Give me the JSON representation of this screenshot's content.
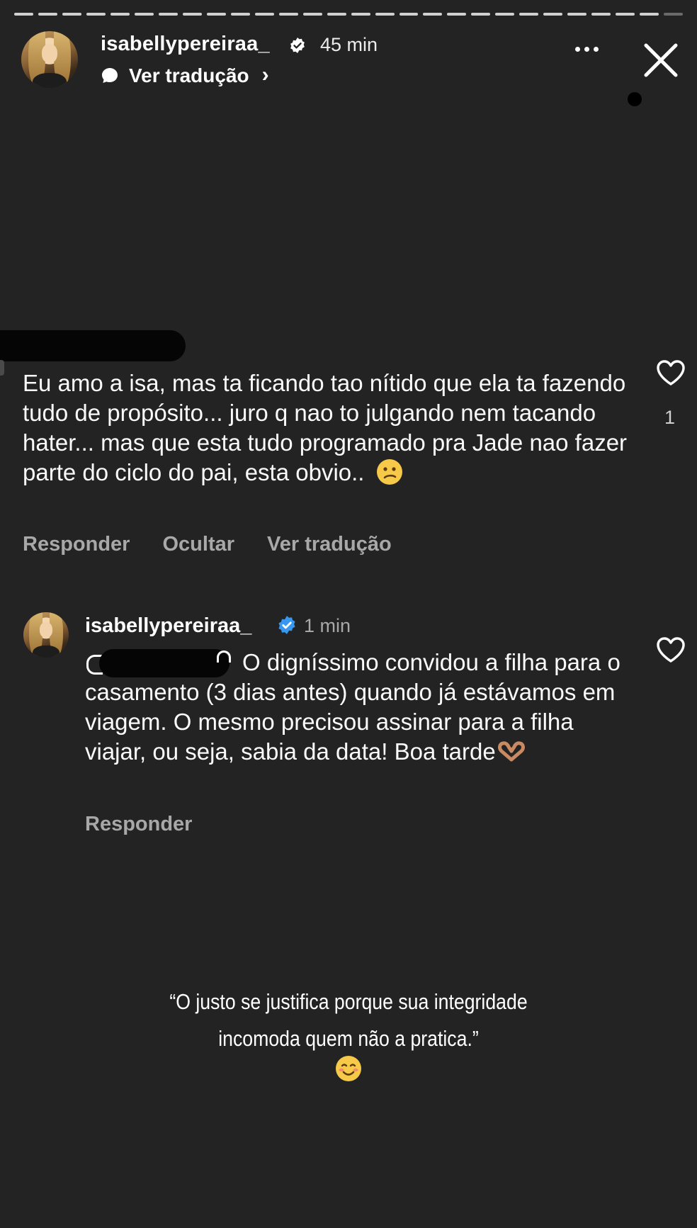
{
  "story": {
    "username": "isabellypereiraa_",
    "time": "45 min",
    "translate_label": "Ver tradução"
  },
  "comment": {
    "text": "Eu amo a isa, mas ta ficando tao nítido que ela ta fazendo tudo de propósito... juro q nao to julgando nem tacando hater... mas que esta tudo programado pra Jade nao fazer parte do ciclo do pai, esta obvio..",
    "likes": "1",
    "actions": {
      "reply": "Responder",
      "hide": "Ocultar",
      "translate": "Ver tradução"
    },
    "emoji": "confused-face"
  },
  "reply": {
    "username": "isabellypereiraa_",
    "time": "1 min",
    "text": "O digníssimo convidou a filha para o casamento (3 dias antes) quando já estávamos em viagem. O mesmo precisou assinar para a filha viajar, ou seja, sabia da data! Boa tarde",
    "emoji": "heart-hands",
    "reply_label": "Responder"
  },
  "quote": {
    "line1": "“O justo se justifica porque sua integridade",
    "line2": "incomoda quem não a pratica.”",
    "emoji": "smiling-face"
  },
  "colors": {
    "background": "#232323",
    "muted": "#a8a8a8",
    "verified": "#3897f0"
  }
}
